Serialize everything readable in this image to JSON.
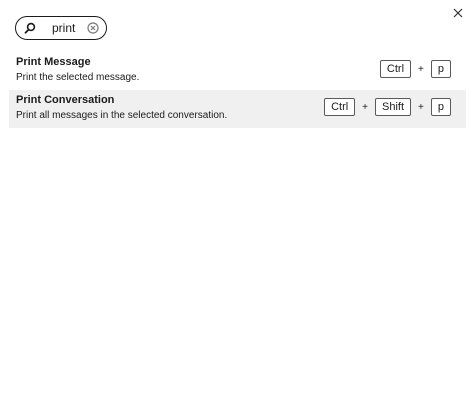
{
  "search": {
    "value": "print"
  },
  "results": [
    {
      "title": "Print Message",
      "description": "Print the selected message.",
      "keys": [
        "Ctrl",
        "p"
      ],
      "selected": false
    },
    {
      "title": "Print Conversation",
      "description": "Print all messages in the selected conversation.",
      "keys": [
        "Ctrl",
        "Shift",
        "p"
      ],
      "selected": true
    }
  ],
  "separator": "+",
  "icons": {
    "close": "close-icon",
    "search": "search-icon",
    "clear": "clear-icon"
  }
}
